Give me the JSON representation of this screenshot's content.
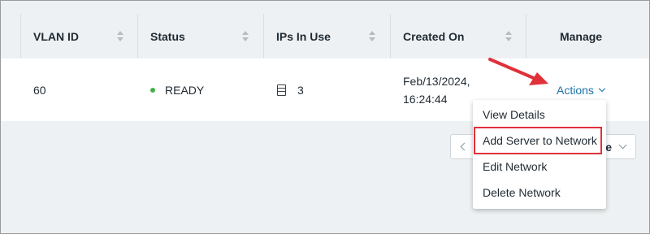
{
  "table": {
    "columns": [
      {
        "label": "VLAN ID",
        "sortable": true
      },
      {
        "label": "Status",
        "sortable": true
      },
      {
        "label": "IPs In Use",
        "sortable": true
      },
      {
        "label": "Created On",
        "sortable": true
      },
      {
        "label": "Manage",
        "sortable": false
      }
    ],
    "rows": [
      {
        "vlan_id": "60",
        "status": "READY",
        "status_color": "#43b049",
        "ips_in_use": "3",
        "ips_icon": "server-icon",
        "created_on_date": "Feb/13/2024,",
        "created_on_time": "16:24:44",
        "manage_label": "Actions"
      }
    ]
  },
  "actions_menu": {
    "items": [
      {
        "label": "View Details"
      },
      {
        "label": "Add Server to Network",
        "highlighted": true
      },
      {
        "label": "Edit Network"
      },
      {
        "label": "Delete Network"
      }
    ]
  },
  "pagination": {
    "right_label_partial": "e"
  },
  "annotation": {
    "arrow_color": "#e0313a",
    "highlight_color": "#e0313a"
  },
  "colors": {
    "link": "#1a73a8",
    "header_bg": "#eef1f3",
    "row_bg": "#ffffff"
  }
}
